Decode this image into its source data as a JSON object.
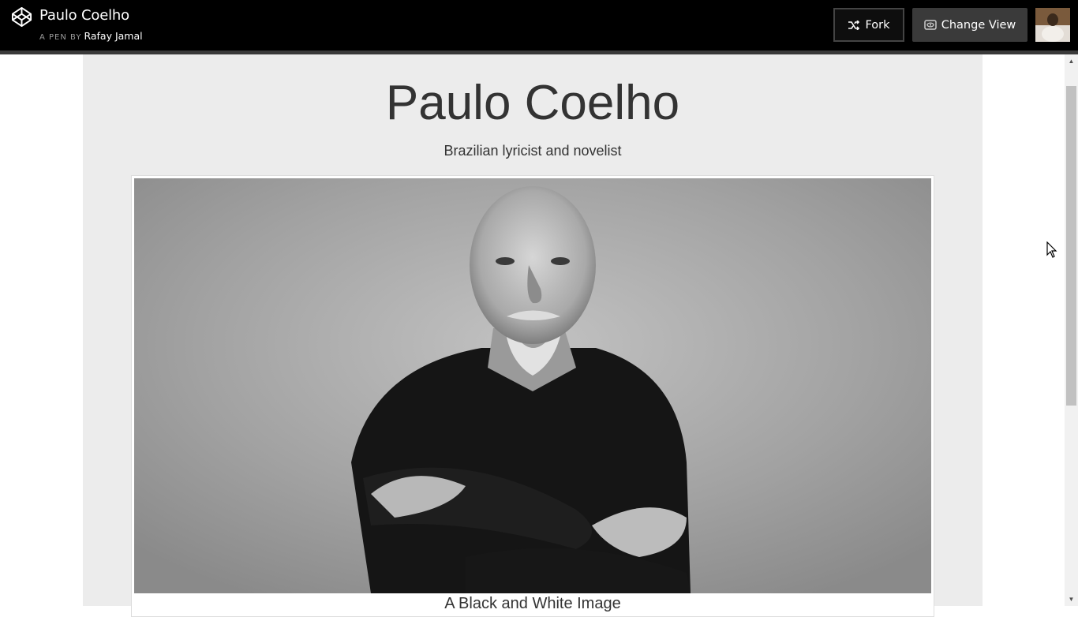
{
  "header": {
    "pen_title": "Paulo Coelho",
    "pen_by": "A PEN BY",
    "author": "Rafay Jamal",
    "fork_label": "Fork",
    "change_view_label": "Change View",
    "logo_icon": "codepen-logo-icon",
    "fork_icon": "fork-icon",
    "view_icon": "eye-icon"
  },
  "main": {
    "title": "Paulo Coelho",
    "subtitle": "Brazilian lyricist and novelist",
    "caption": "A Black and White Image"
  },
  "colors": {
    "topbar_bg": "#000000",
    "page_bg": "#ececec",
    "text": "#333333",
    "change_view_bg": "#3a3a3a"
  }
}
